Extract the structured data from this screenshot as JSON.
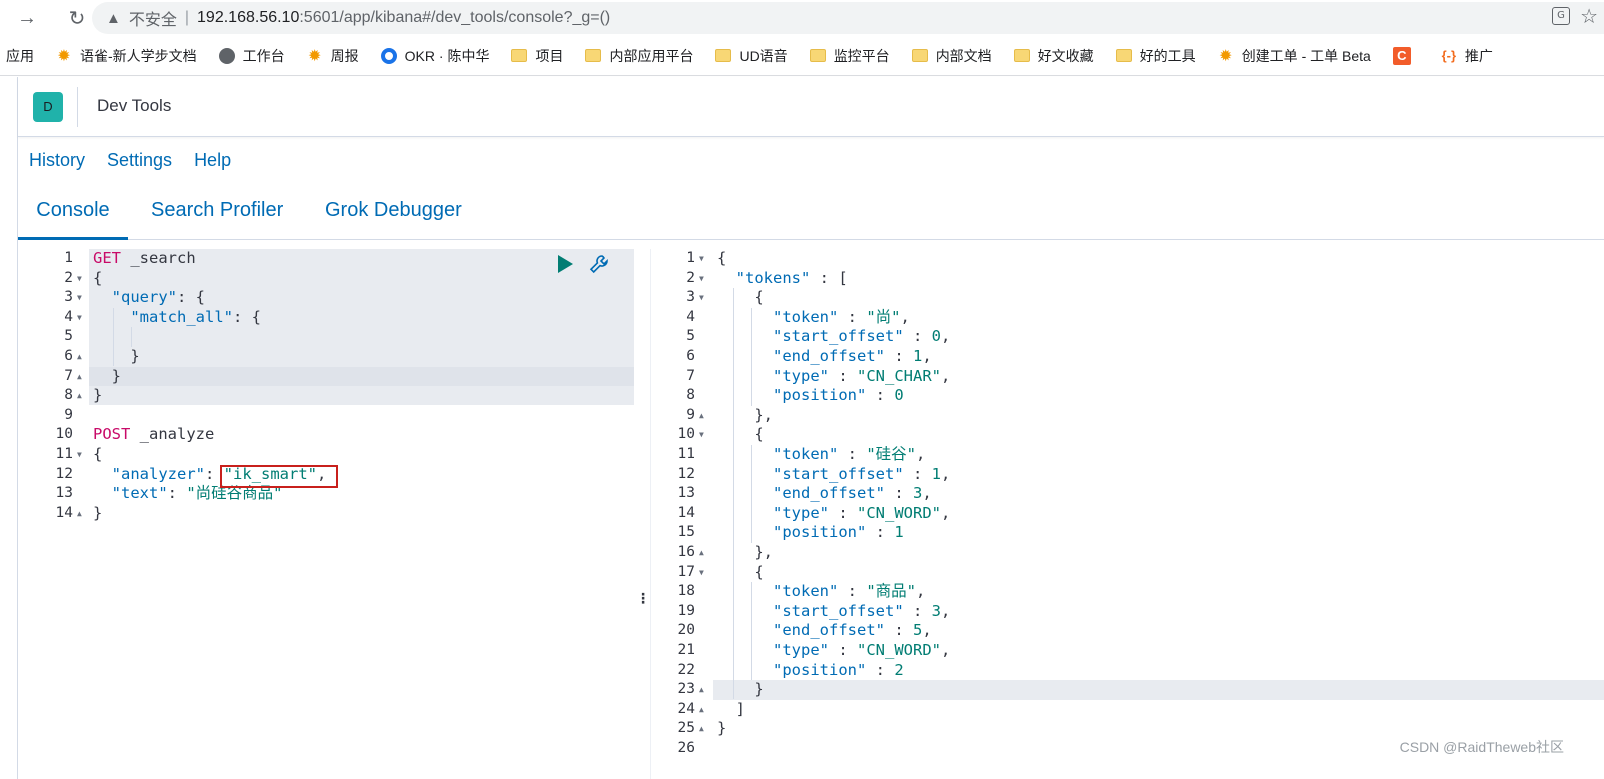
{
  "browser": {
    "insecure_label": "不安全",
    "url_host": "192.168.56.10",
    "url_path": ":5601/app/kibana#/dev_tools/console?_g=()",
    "bookmarks": [
      {
        "label": "应用",
        "icon": "none"
      },
      {
        "label": "语雀-新人学步文档",
        "icon": "gear"
      },
      {
        "label": "工作台",
        "icon": "globe"
      },
      {
        "label": "周报",
        "icon": "gear"
      },
      {
        "label": "OKR · 陈中华",
        "icon": "okr"
      },
      {
        "label": "项目",
        "icon": "folder"
      },
      {
        "label": "内部应用平台",
        "icon": "folder"
      },
      {
        "label": "UD语音",
        "icon": "folder"
      },
      {
        "label": "监控平台",
        "icon": "folder"
      },
      {
        "label": "内部文档",
        "icon": "folder"
      },
      {
        "label": "好文收藏",
        "icon": "folder"
      },
      {
        "label": "好的工具",
        "icon": "folder"
      },
      {
        "label": "创建工单 - 工单 Beta",
        "icon": "gear"
      },
      {
        "label": "",
        "icon": "c"
      },
      {
        "label": "推广",
        "icon": "bracket"
      }
    ]
  },
  "kibana": {
    "avatar": "D",
    "title": "Dev Tools",
    "menu": [
      "History",
      "Settings",
      "Help"
    ],
    "tabs": [
      "Console",
      "Search Profiler",
      "Grok Debugger"
    ]
  },
  "request_editor": {
    "lines": [
      [
        {
          "t": "GET",
          "c": "method"
        },
        {
          "t": " _search",
          "c": "path"
        }
      ],
      [
        {
          "t": "{",
          "c": "punc"
        }
      ],
      [
        {
          "t": "  ",
          "c": "punc"
        },
        {
          "t": "\"query\"",
          "c": "key"
        },
        {
          "t": ": {",
          "c": "punc"
        }
      ],
      [
        {
          "t": "    ",
          "c": "punc"
        },
        {
          "t": "\"match_all\"",
          "c": "key"
        },
        {
          "t": ": {",
          "c": "punc"
        }
      ],
      [
        {
          "t": "",
          "c": "punc"
        }
      ],
      [
        {
          "t": "    }",
          "c": "punc"
        }
      ],
      [
        {
          "t": "  }",
          "c": "punc"
        }
      ],
      [
        {
          "t": "}",
          "c": "punc"
        }
      ],
      [
        {
          "t": "",
          "c": "punc"
        }
      ],
      [
        {
          "t": "POST",
          "c": "method"
        },
        {
          "t": " _analyze",
          "c": "path"
        }
      ],
      [
        {
          "t": "{",
          "c": "punc"
        }
      ],
      [
        {
          "t": "  ",
          "c": "punc"
        },
        {
          "t": "\"analyzer\"",
          "c": "key"
        },
        {
          "t": ": ",
          "c": "punc"
        },
        {
          "t": "\"ik_smart\"",
          "c": "str"
        },
        {
          "t": ",",
          "c": "punc"
        }
      ],
      [
        {
          "t": "  ",
          "c": "punc"
        },
        {
          "t": "\"text\"",
          "c": "key"
        },
        {
          "t": ": ",
          "c": "punc"
        },
        {
          "t": "\"尚硅谷商品\"",
          "c": "str"
        }
      ],
      [
        {
          "t": "}",
          "c": "punc"
        }
      ]
    ]
  },
  "response_editor": {
    "lines": [
      [
        {
          "t": "{",
          "c": "punc"
        }
      ],
      [
        {
          "t": "  ",
          "c": "punc"
        },
        {
          "t": "\"tokens\"",
          "c": "key"
        },
        {
          "t": " : [",
          "c": "punc"
        }
      ],
      [
        {
          "t": "    {",
          "c": "punc"
        }
      ],
      [
        {
          "t": "      ",
          "c": "punc"
        },
        {
          "t": "\"token\"",
          "c": "key"
        },
        {
          "t": " : ",
          "c": "punc"
        },
        {
          "t": "\"尚\"",
          "c": "str"
        },
        {
          "t": ",",
          "c": "punc"
        }
      ],
      [
        {
          "t": "      ",
          "c": "punc"
        },
        {
          "t": "\"start_offset\"",
          "c": "key"
        },
        {
          "t": " : ",
          "c": "punc"
        },
        {
          "t": "0",
          "c": "num"
        },
        {
          "t": ",",
          "c": "punc"
        }
      ],
      [
        {
          "t": "      ",
          "c": "punc"
        },
        {
          "t": "\"end_offset\"",
          "c": "key"
        },
        {
          "t": " : ",
          "c": "punc"
        },
        {
          "t": "1",
          "c": "num"
        },
        {
          "t": ",",
          "c": "punc"
        }
      ],
      [
        {
          "t": "      ",
          "c": "punc"
        },
        {
          "t": "\"type\"",
          "c": "key"
        },
        {
          "t": " : ",
          "c": "punc"
        },
        {
          "t": "\"CN_CHAR\"",
          "c": "str"
        },
        {
          "t": ",",
          "c": "punc"
        }
      ],
      [
        {
          "t": "      ",
          "c": "punc"
        },
        {
          "t": "\"position\"",
          "c": "key"
        },
        {
          "t": " : ",
          "c": "punc"
        },
        {
          "t": "0",
          "c": "num"
        }
      ],
      [
        {
          "t": "    },",
          "c": "punc"
        }
      ],
      [
        {
          "t": "    {",
          "c": "punc"
        }
      ],
      [
        {
          "t": "      ",
          "c": "punc"
        },
        {
          "t": "\"token\"",
          "c": "key"
        },
        {
          "t": " : ",
          "c": "punc"
        },
        {
          "t": "\"硅谷\"",
          "c": "str"
        },
        {
          "t": ",",
          "c": "punc"
        }
      ],
      [
        {
          "t": "      ",
          "c": "punc"
        },
        {
          "t": "\"start_offset\"",
          "c": "key"
        },
        {
          "t": " : ",
          "c": "punc"
        },
        {
          "t": "1",
          "c": "num"
        },
        {
          "t": ",",
          "c": "punc"
        }
      ],
      [
        {
          "t": "      ",
          "c": "punc"
        },
        {
          "t": "\"end_offset\"",
          "c": "key"
        },
        {
          "t": " : ",
          "c": "punc"
        },
        {
          "t": "3",
          "c": "num"
        },
        {
          "t": ",",
          "c": "punc"
        }
      ],
      [
        {
          "t": "      ",
          "c": "punc"
        },
        {
          "t": "\"type\"",
          "c": "key"
        },
        {
          "t": " : ",
          "c": "punc"
        },
        {
          "t": "\"CN_WORD\"",
          "c": "str"
        },
        {
          "t": ",",
          "c": "punc"
        }
      ],
      [
        {
          "t": "      ",
          "c": "punc"
        },
        {
          "t": "\"position\"",
          "c": "key"
        },
        {
          "t": " : ",
          "c": "punc"
        },
        {
          "t": "1",
          "c": "num"
        }
      ],
      [
        {
          "t": "    },",
          "c": "punc"
        }
      ],
      [
        {
          "t": "    {",
          "c": "punc"
        }
      ],
      [
        {
          "t": "      ",
          "c": "punc"
        },
        {
          "t": "\"token\"",
          "c": "key"
        },
        {
          "t": " : ",
          "c": "punc"
        },
        {
          "t": "\"商品\"",
          "c": "str"
        },
        {
          "t": ",",
          "c": "punc"
        }
      ],
      [
        {
          "t": "      ",
          "c": "punc"
        },
        {
          "t": "\"start_offset\"",
          "c": "key"
        },
        {
          "t": " : ",
          "c": "punc"
        },
        {
          "t": "3",
          "c": "num"
        },
        {
          "t": ",",
          "c": "punc"
        }
      ],
      [
        {
          "t": "      ",
          "c": "punc"
        },
        {
          "t": "\"end_offset\"",
          "c": "key"
        },
        {
          "t": " : ",
          "c": "punc"
        },
        {
          "t": "5",
          "c": "num"
        },
        {
          "t": ",",
          "c": "punc"
        }
      ],
      [
        {
          "t": "      ",
          "c": "punc"
        },
        {
          "t": "\"type\"",
          "c": "key"
        },
        {
          "t": " : ",
          "c": "punc"
        },
        {
          "t": "\"CN_WORD\"",
          "c": "str"
        },
        {
          "t": ",",
          "c": "punc"
        }
      ],
      [
        {
          "t": "      ",
          "c": "punc"
        },
        {
          "t": "\"position\"",
          "c": "key"
        },
        {
          "t": " : ",
          "c": "punc"
        },
        {
          "t": "2",
          "c": "num"
        }
      ],
      [
        {
          "t": "    }",
          "c": "punc"
        }
      ],
      [
        {
          "t": "  ]",
          "c": "punc"
        }
      ],
      [
        {
          "t": "}",
          "c": "punc"
        }
      ],
      [
        {
          "t": "",
          "c": "punc"
        }
      ]
    ]
  },
  "fold_markers_left": [
    "",
    "down",
    "down",
    "down",
    "",
    "up",
    "up",
    "up",
    "",
    "",
    "down",
    "",
    "",
    "up"
  ],
  "fold_markers_right": [
    "down",
    "down",
    "down",
    "",
    "",
    "",
    "",
    "",
    "up",
    "down",
    "",
    "",
    "",
    "",
    "",
    "up",
    "down",
    "",
    "",
    "",
    "",
    "",
    "up",
    "up",
    "up",
    ""
  ],
  "watermark": "CSDN @RaidTheweb社区"
}
